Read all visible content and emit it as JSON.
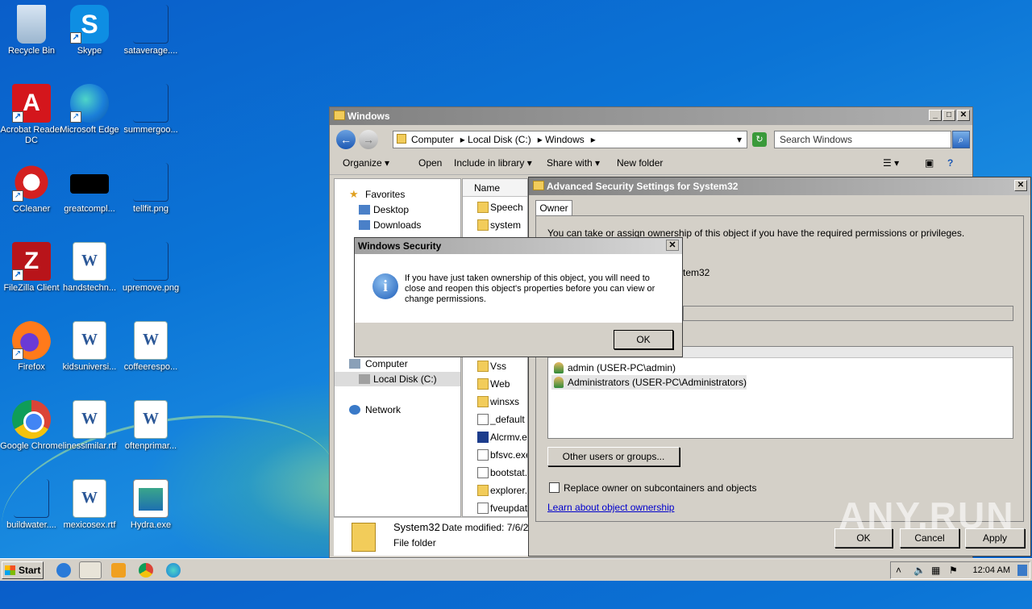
{
  "desktop_icons": [
    {
      "label": "Recycle Bin"
    },
    {
      "label": "Skype"
    },
    {
      "label": "sataverage...."
    },
    {
      "label": "Acrobat Reader DC"
    },
    {
      "label": "Microsoft Edge"
    },
    {
      "label": "summergoo..."
    },
    {
      "label": "CCleaner"
    },
    {
      "label": "greatcompl..."
    },
    {
      "label": "tellfit.png"
    },
    {
      "label": "FileZilla Client"
    },
    {
      "label": "handstechn..."
    },
    {
      "label": "upremove.png"
    },
    {
      "label": "Firefox"
    },
    {
      "label": "kidsuniversi..."
    },
    {
      "label": "coffeerespo..."
    },
    {
      "label": "Google Chrome"
    },
    {
      "label": "linessimilar.rtf"
    },
    {
      "label": "oftenprimar..."
    },
    {
      "label": "buildwater...."
    },
    {
      "label": "mexicosex.rtf"
    },
    {
      "label": "Hydra.exe"
    }
  ],
  "explorer": {
    "title": "Windows",
    "address": [
      "Computer",
      "Local Disk (C:)",
      "Windows"
    ],
    "search_placeholder": "Search Windows",
    "toolbar": {
      "organize": "Organize",
      "open": "Open",
      "include": "Include in library",
      "share": "Share with",
      "new_folder": "New folder"
    },
    "nav": {
      "favorites": "Favorites",
      "desktop": "Desktop",
      "downloads": "Downloads",
      "computer": "Computer",
      "local_disk": "Local Disk (C:)",
      "network": "Network"
    },
    "name_header": "Name",
    "files_top": [
      "Speech",
      "system"
    ],
    "files_bottom": [
      "Vss",
      "Web",
      "winsxs",
      "_default",
      "Alcrmv.ex",
      "bfsvc.exe",
      "bootstat.",
      "explorer.e",
      "fveupdat"
    ],
    "details": {
      "name": "System32",
      "modified": "Date modified: 7/6/20",
      "type": "File folder"
    }
  },
  "advanced": {
    "title": "Advanced Security Settings for System32",
    "tab": "Owner",
    "intro": "You can take or assign ownership of this object if you have the required permissions or privileges.",
    "current_owner_partial": "tem32",
    "owners": [
      "admin (USER-PC\\admin)",
      "Administrators (USER-PC\\Administrators)"
    ],
    "other_users_button": "Other users or groups...",
    "replace_owner": "Replace owner on subcontainers and objects",
    "learn_link": "Learn about object ownership",
    "ok": "OK",
    "cancel": "Cancel",
    "apply": "Apply"
  },
  "msgbox": {
    "title": "Windows Security",
    "text": "If you have just taken ownership of this object, you will need to close and reopen this object's properties before you can view or change permissions.",
    "ok": "OK"
  },
  "taskbar": {
    "start": "Start",
    "clock": "12:04 AM"
  },
  "watermark": "ANY.RUN"
}
